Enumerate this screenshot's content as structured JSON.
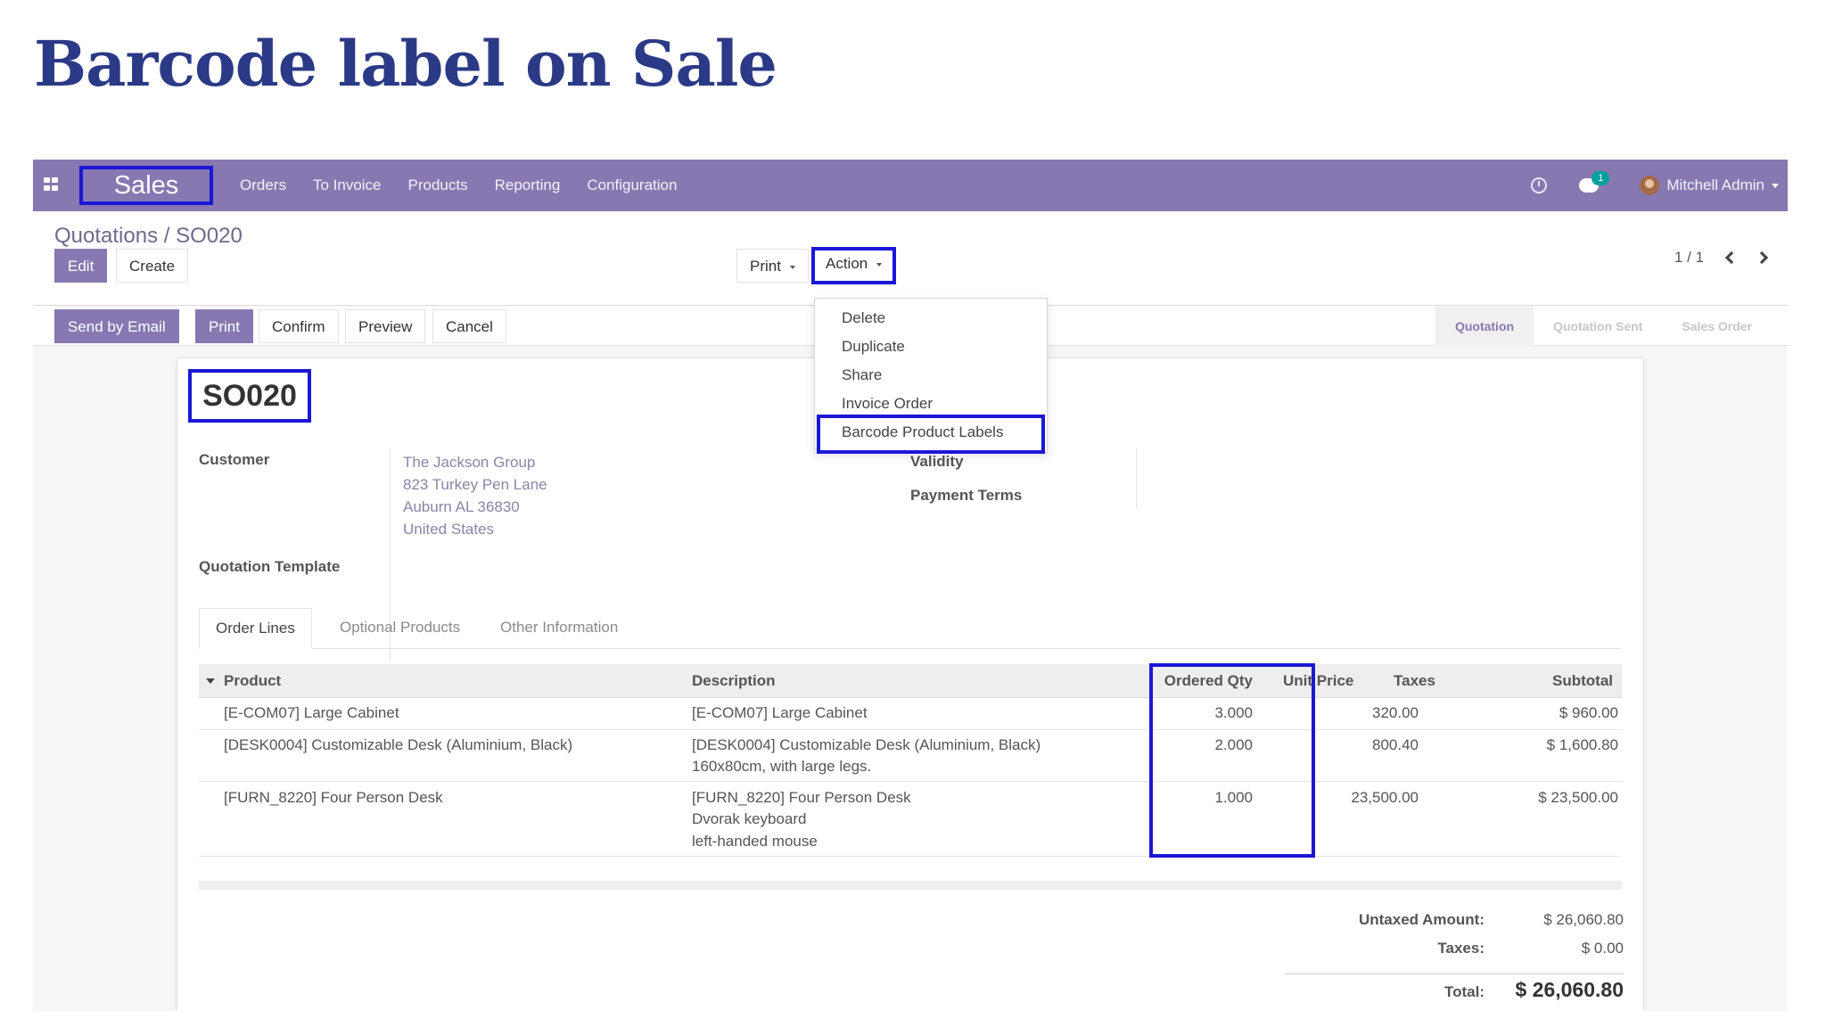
{
  "slide": {
    "title": "Barcode label on Sale"
  },
  "navbar": {
    "brand": "Sales",
    "menu": [
      "Orders",
      "To Invoice",
      "Products",
      "Reporting",
      "Configuration"
    ],
    "chat_count": "1",
    "user": "Mitchell Admin"
  },
  "control": {
    "breadcrumb_parent": "Quotations",
    "breadcrumb_sep": "/",
    "breadcrumb_current": "SO020",
    "edit": "Edit",
    "create": "Create",
    "print": "Print",
    "action": "Action",
    "pager": "1 / 1"
  },
  "statusbar": {
    "buttons": [
      "Send by Email",
      "Print",
      "Confirm",
      "Preview",
      "Cancel"
    ],
    "stages": [
      "Quotation",
      "Quotation Sent",
      "Sales Order"
    ]
  },
  "action_menu": [
    "Delete",
    "Duplicate",
    "Share",
    "Invoice Order",
    "Barcode Product Labels"
  ],
  "sheet": {
    "name": "SO020",
    "customer_label": "Customer",
    "customer_lines": [
      "The Jackson Group",
      "823 Turkey Pen Lane",
      "Auburn AL 36830",
      "United States"
    ],
    "template_label": "Quotation Template",
    "validity_label": "Validity",
    "payment_terms_label": "Payment Terms"
  },
  "tabs": [
    "Order Lines",
    "Optional Products",
    "Other Information"
  ],
  "table": {
    "headers": [
      "Product",
      "Description",
      "Ordered Qty",
      "Unit Price",
      "Taxes",
      "Subtotal"
    ],
    "rows": [
      {
        "product": "[E-COM07] Large Cabinet",
        "desc": [
          "[E-COM07] Large Cabinet"
        ],
        "qty": "3.000",
        "price": "320.00",
        "subtotal": "$ 960.00"
      },
      {
        "product": "[DESK0004] Customizable Desk (Aluminium, Black)",
        "desc": [
          "[DESK0004] Customizable Desk (Aluminium, Black)",
          "160x80cm, with large legs."
        ],
        "qty": "2.000",
        "price": "800.40",
        "subtotal": "$ 1,600.80"
      },
      {
        "product": "[FURN_8220] Four Person Desk",
        "desc": [
          "[FURN_8220] Four Person Desk",
          "Dvorak keyboard",
          "left-handed mouse"
        ],
        "qty": "1.000",
        "price": "23,500.00",
        "subtotal": "$ 23,500.00"
      }
    ]
  },
  "totals": {
    "untaxed_label": "Untaxed Amount:",
    "untaxed": "$ 26,060.80",
    "taxes_label": "Taxes:",
    "taxes": "$ 0.00",
    "total_label": "Total:",
    "total": "$ 26,060.80"
  },
  "colors": {
    "brand": "#8778b1",
    "highlight": "#1a17d6",
    "title": "#2b3a86"
  }
}
